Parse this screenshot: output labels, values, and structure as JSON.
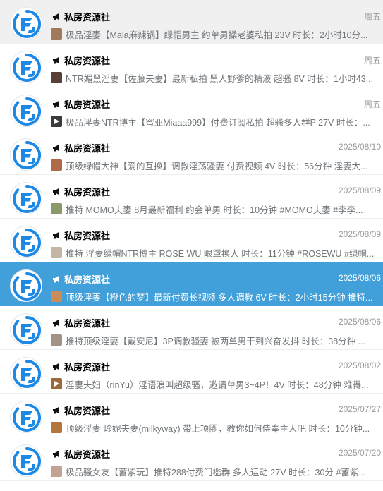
{
  "chat_list": {
    "items": [
      {
        "name": "私房资源社",
        "date": "周五",
        "thumb_color": "#a07a5c",
        "thumb_video": false,
        "text": "极品淫妻【Mala麻辣锅】绿帽男主 约单男操老婆私拍 23V 时长：2小时10分..."
      },
      {
        "name": "私房资源社",
        "date": "周五",
        "thumb_color": "#5a3f38",
        "thumb_video": false,
        "text": "NTR媚黑淫妻【佐藤夫妻】最新私拍 黑人野爹的精液 超骚 8V 时长：1小时43..."
      },
      {
        "name": "私房资源社",
        "date": "周五",
        "thumb_color": "#3b3b3b",
        "thumb_video": true,
        "text": "极品淫妻NTR博主【蜜亚Miaaa999】付费订阅私拍 超骚多人群P 27V 时长：..."
      },
      {
        "name": "私房资源社",
        "date": "2025/08/10",
        "thumb_color": "#b06a4a",
        "thumb_video": false,
        "text": "顶级绿帽大神【爱的互换】调教淫荡骚妻 付费视频 4V 时长：56分钟 淫妻大..."
      },
      {
        "name": "私房资源社",
        "date": "2025/08/09",
        "thumb_color": "#8a9a6a",
        "thumb_video": false,
        "text": "推特 MOMO夫妻 8月最新福利 约会单男 时长：10分钟 #MOMO夫妻 #李李..."
      },
      {
        "name": "私房资源社",
        "date": "2025/08/09",
        "thumb_color": "#c4b6a4",
        "thumb_video": false,
        "text": "推特 淫妻绿帽NTR博主 ROSE WU 眼罩换人 时长：11分钟 #ROSEWU #绿帽..."
      },
      {
        "name": "私房资源社",
        "date": "2025/08/06",
        "thumb_color": "#c98c5a",
        "thumb_video": false,
        "text": "顶级淫妻【橙色的梦】最新付费长视频 多人调教 6V 时长：2小时15分钟 推特..."
      },
      {
        "name": "私房资源社",
        "date": "2025/08/06",
        "thumb_color": "#a39386",
        "thumb_video": false,
        "text": "推特顶级淫妻【戴安尼】3P调教骚妻 被两单男干到兴奋发抖 时长：38分钟 ..."
      },
      {
        "name": "私房资源社",
        "date": "2025/08/02",
        "thumb_color": "#9a6a3a",
        "thumb_video": true,
        "text": "淫妻夫妇（rinYu）淫语浪叫超级骚，邀请单男3~4P！4V 时长：48分钟 难得..."
      },
      {
        "name": "私房资源社",
        "date": "2025/07/27",
        "thumb_color": "#b4763c",
        "thumb_video": false,
        "text": "顶级淫妻 珍妮夫妻(milkyway) 带上项圈，教你如何侍奉主人吧 时长：10分钟..."
      },
      {
        "name": "私房资源社",
        "date": "2025/07/20",
        "thumb_color": "#c2a292",
        "thumb_video": false,
        "text": "极品骚女友【蓄紫玩】推特288付费门槛群 多人运动 27V 时长：30分 #蓄紫..."
      }
    ]
  },
  "colors": {
    "selected_bg": "#419fd9",
    "logo_blue": "#1e88e5"
  },
  "icons": {
    "avatar": "channel-logo-icon",
    "channel_marker": "megaphone-icon"
  }
}
